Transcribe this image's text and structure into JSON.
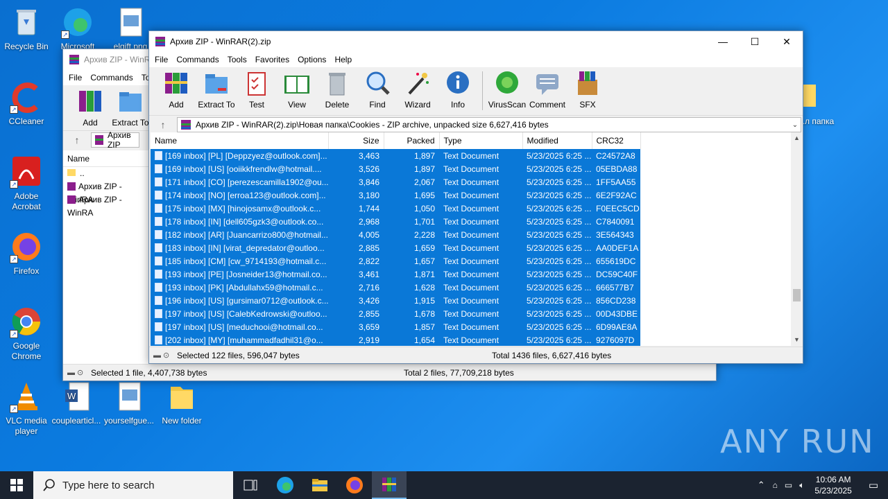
{
  "desktop": {
    "icons": [
      {
        "label": "Recycle Bin"
      },
      {
        "label": "Microsoft"
      },
      {
        "label": "elgift.png"
      },
      {
        "label": "CCleaner"
      },
      {
        "label": "Adobe Acrobat"
      },
      {
        "label": "Firefox"
      },
      {
        "label": "Google Chrome"
      },
      {
        "label": "VLC media player"
      },
      {
        "label": "couplearticl..."
      },
      {
        "label": "yourselfgue..."
      },
      {
        "label": "New folder"
      },
      {
        "label": "...л папка"
      }
    ],
    "watermark": "ANY RUN"
  },
  "back_window": {
    "title": "Архив ZIP - WinRAR",
    "menu": [
      "File",
      "Commands",
      "To"
    ],
    "toolbar": [
      "Add",
      "Extract To"
    ],
    "path": "Архив ZIP",
    "col_name": "Name",
    "rows": [
      "..",
      "Архив ZIP - WinRA",
      "Архив ZIP - WinRA"
    ],
    "status_left": "Selected 1 file, 4,407,738 bytes",
    "status_right": "Total 2 files, 77,709,218 bytes"
  },
  "main_window": {
    "title": "Архив ZIP - WinRAR(2).zip",
    "menu": [
      "File",
      "Commands",
      "Tools",
      "Favorites",
      "Options",
      "Help"
    ],
    "toolbar": [
      "Add",
      "Extract To",
      "Test",
      "View",
      "Delete",
      "Find",
      "Wizard",
      "Info",
      "VirusScan",
      "Comment",
      "SFX"
    ],
    "path": "Архив ZIP - WinRAR(2).zip\\Новая папка\\Cookies - ZIP archive, unpacked size 6,627,416 bytes",
    "columns": [
      "Name",
      "Size",
      "Packed",
      "Type",
      "Modified",
      "CRC32"
    ],
    "rows": [
      [
        "[169 inbox] [PL] [Deppzyez@outlook.com]...",
        "3,463",
        "1,897",
        "Text Document",
        "5/23/2025 6:25 ...",
        "C24572A8"
      ],
      [
        "[169 inbox] [US] [ooiikkfrendlw@hotmail....",
        "3,526",
        "1,897",
        "Text Document",
        "5/23/2025 6:25 ...",
        "05EBDA88"
      ],
      [
        "[171 inbox] [CO] [perezescamilla1902@ou...",
        "3,846",
        "2,067",
        "Text Document",
        "5/23/2025 6:25 ...",
        "1FF5AA55"
      ],
      [
        "[174 inbox] [NO] [erroa123@outlook.com]...",
        "3,180",
        "1,695",
        "Text Document",
        "5/23/2025 6:25 ...",
        "6E2F92AC"
      ],
      [
        "[175 inbox] [MX] [hinojosamx@outlook.c...",
        "1,744",
        "1,050",
        "Text Document",
        "5/23/2025 6:25 ...",
        "F0EEC5CD"
      ],
      [
        "[178 inbox] [IN] [dell605gzk3@outlook.co...",
        "2,968",
        "1,701",
        "Text Document",
        "5/23/2025 6:25 ...",
        "C7840091"
      ],
      [
        "[182 inbox] [AR] [Juancarrizo800@hotmail...",
        "4,005",
        "2,228",
        "Text Document",
        "5/23/2025 6:25 ...",
        "3E564343"
      ],
      [
        "[183 inbox] [IN] [virat_depredator@outloo...",
        "2,885",
        "1,659",
        "Text Document",
        "5/23/2025 6:25 ...",
        "AA0DEF1A"
      ],
      [
        "[185 inbox] [CM] [cw_9714193@hotmail.c...",
        "2,822",
        "1,657",
        "Text Document",
        "5/23/2025 6:25 ...",
        "655619DC"
      ],
      [
        "[193 inbox] [PE] [Josneider13@hotmail.co...",
        "3,461",
        "1,871",
        "Text Document",
        "5/23/2025 6:25 ...",
        "DC59C40F"
      ],
      [
        "[193 inbox] [PK] [Abdullahx59@hotmail.c...",
        "2,716",
        "1,628",
        "Text Document",
        "5/23/2025 6:25 ...",
        "666577B7"
      ],
      [
        "[196 inbox] [US] [gursimar0712@outlook.c...",
        "3,426",
        "1,915",
        "Text Document",
        "5/23/2025 6:25 ...",
        "856CD238"
      ],
      [
        "[197 inbox] [US] [CalebKedrowski@outloo...",
        "2,855",
        "1,678",
        "Text Document",
        "5/23/2025 6:25 ...",
        "00D43DBE"
      ],
      [
        "[197 inbox] [US] [meduchooi@hotmail.co...",
        "3,659",
        "1,857",
        "Text Document",
        "5/23/2025 6:25 ...",
        "6D99AE8A"
      ],
      [
        "[202 inbox] [MY] [muhammadfadhil31@o...",
        "2,919",
        "1,654",
        "Text Document",
        "5/23/2025 6:25 ...",
        "9276097D"
      ]
    ],
    "status_left": "Selected 122 files, 596,047 bytes",
    "status_right": "Total 1436 files, 6,627,416 bytes"
  },
  "taskbar": {
    "search_placeholder": "Type here to search",
    "time": "10:06 AM",
    "date": "5/23/2025"
  }
}
